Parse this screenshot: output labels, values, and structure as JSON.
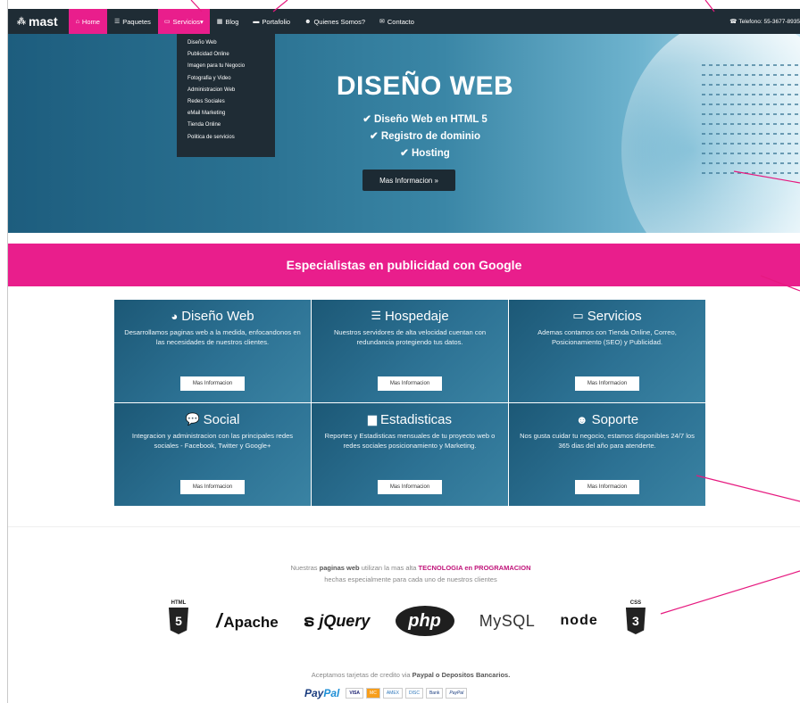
{
  "nav": {
    "brand": "mast",
    "items": [
      {
        "icon": "home-icon",
        "glyph": "⌂",
        "label": "Home"
      },
      {
        "icon": "cart-icon",
        "glyph": "☰",
        "label": "Paquetes"
      },
      {
        "icon": "monitor-icon",
        "glyph": "▭",
        "label": "Servicios"
      },
      {
        "icon": "grid-icon",
        "glyph": "▦",
        "label": "Blog"
      },
      {
        "icon": "briefcase-icon",
        "glyph": "▬",
        "label": "Portafolio"
      },
      {
        "icon": "users-icon",
        "glyph": "☻",
        "label": "Quienes Somos?"
      },
      {
        "icon": "envelope-icon",
        "glyph": "✉",
        "label": "Contacto"
      }
    ],
    "phone": "Telefono: 55-3677-8935"
  },
  "dropdown": {
    "items": [
      "Diseño Web",
      "Publicidad Online",
      "Imagen para tu Negocio",
      "Fotografia y Video",
      "Administracion Web",
      "Redes Sociales",
      "eMail Marketing",
      "Tienda Online",
      "Politica de servicios"
    ]
  },
  "hero": {
    "title": "DISEÑO WEB",
    "lines": [
      "✔ Diseño Web en HTML 5",
      "✔ Registro de dominio",
      "✔ Hosting"
    ],
    "button": "Mas Informacion »"
  },
  "banner": {
    "text": "Especialistas en publicidad con Google"
  },
  "services": [
    {
      "icon": "globe-icon",
      "glyph": "◕",
      "title": "Diseño Web",
      "desc": "Desarrollamos paginas web a la medida, enfocandonos en las necesidades de nuestros clientes.",
      "button": "Mas Informacion"
    },
    {
      "icon": "server-icon",
      "glyph": "☰",
      "title": "Hospedaje",
      "desc": "Nuestros servidores de alta velocidad cuentan con redundancia protegiendo tus datos.",
      "button": "Mas Informacion"
    },
    {
      "icon": "desktop-icon",
      "glyph": "▭",
      "title": "Servicios",
      "desc": "Ademas contamos con Tienda Online, Correo, Posicionamiento (SEO) y Publicidad.",
      "button": "Mas Informacion"
    },
    {
      "icon": "chat-icon",
      "glyph": "💬",
      "title": "Social",
      "desc": "Integracion y administracion con las principales redes sociales - Facebook, Twitter y Google+",
      "button": "Mas Informacion"
    },
    {
      "icon": "bar-chart-icon",
      "glyph": "▆",
      "title": "Estadisticas",
      "desc": "Reportes y Estadisticas mensuales de tu proyecto web o redes sociales posicionamiento y Marketing.",
      "button": "Mas Informacion"
    },
    {
      "icon": "group-icon",
      "glyph": "☻",
      "title": "Soporte",
      "desc": "Nos gusta cuidar tu negocio, estamos disponibles 24/7 los 365 dias del año para atenderte.",
      "button": "Mas Informacion"
    }
  ],
  "tech": {
    "line1_a": "Nuestras",
    "line1_b": "paginas web",
    "line1_c": "utilizan la mas alta",
    "line1_d": "TECNOLOGIA en PROGRAMACION",
    "line2": "hechas especialmente para cada uno de nuestros clientes",
    "logos": {
      "html5_label": "HTML",
      "html5_num": "5",
      "apache": "Apache",
      "jquery": "jQuery",
      "php": "php",
      "mysql": "MySQL",
      "node": "node",
      "css3_label": "CSS",
      "css3_num": "3"
    }
  },
  "payment": {
    "text_a": "Aceptamos tarjetas de credito via",
    "text_b": "Paypal o Depositos Bancarios.",
    "paypal_a": "Pay",
    "paypal_b": "Pal",
    "cards": [
      "VISA",
      "MC",
      "AMEX",
      "DISC",
      "Bank",
      "PayPal"
    ]
  },
  "colors": {
    "accent": "#e91e8c",
    "nav": "#1f2c35",
    "card": "#2c7193"
  }
}
